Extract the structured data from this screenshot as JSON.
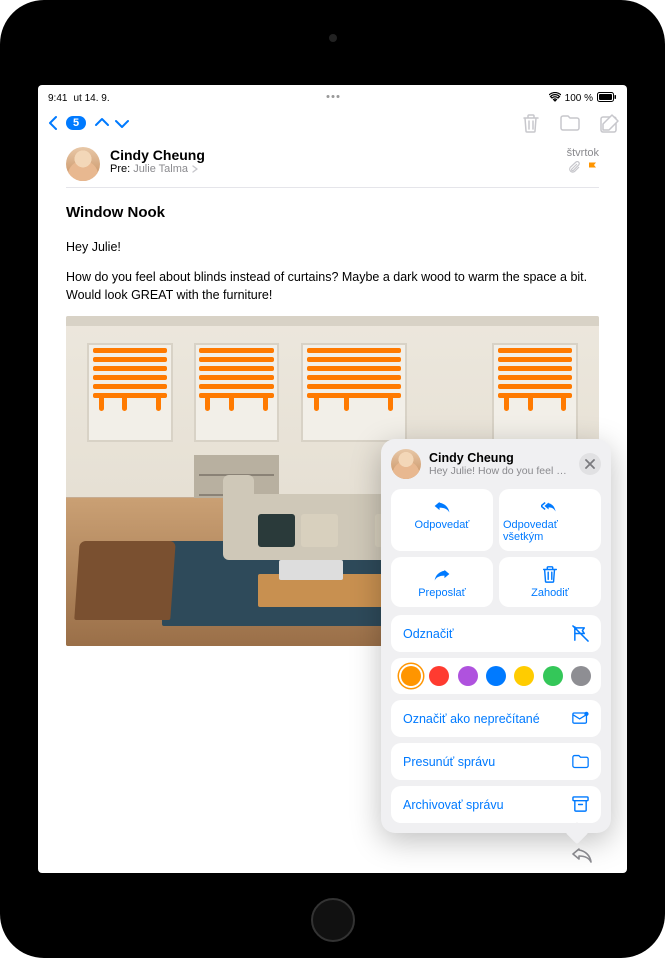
{
  "status": {
    "time": "9:41",
    "date": "ut 14. 9.",
    "battery": "100 %"
  },
  "toolbar": {
    "unread_count": "5"
  },
  "email": {
    "sender": "Cindy Cheung",
    "to_label": "Pre:",
    "recipient": "Julie Talma",
    "day": "štvrtok",
    "subject": "Window Nook",
    "greeting": "Hey Julie!",
    "body": "How do you feel about blinds instead of curtains? Maybe a dark wood to warm the space a bit. Would look GREAT with the furniture!"
  },
  "popover": {
    "sender": "Cindy Cheung",
    "snippet": "Hey Julie! How do you feel ab...",
    "reply": "Odpovedať",
    "reply_all": "Odpovedať všetkým",
    "forward": "Preposlať",
    "trash": "Zahodiť",
    "unflag": "Odznačiť",
    "mark_unread": "Označiť ako neprečítané",
    "move": "Presunúť správu",
    "archive": "Archivovať správu",
    "flag_colors": [
      "#ff9500",
      "#ff3b30",
      "#af52de",
      "#007aff",
      "#ffcc00",
      "#34c759",
      "#8e8e93"
    ]
  }
}
